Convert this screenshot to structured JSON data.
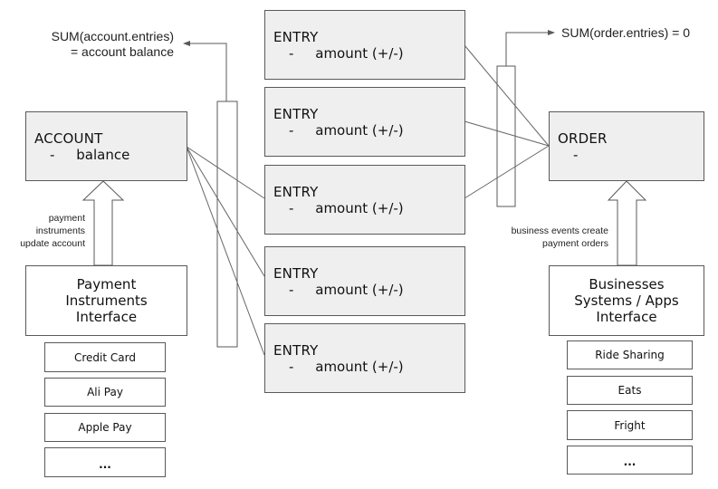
{
  "colors": {
    "box_fill": "#efefef",
    "stroke": "#595959",
    "background": "#ffffff"
  },
  "account": {
    "title": "ACCOUNT",
    "field": "-     balance"
  },
  "order": {
    "title": "ORDER",
    "field": "-"
  },
  "entries": [
    {
      "title": "ENTRY",
      "field": "-     amount (+/-)"
    },
    {
      "title": "ENTRY",
      "field": "-     amount (+/-)"
    },
    {
      "title": "ENTRY",
      "field": "-     amount (+/-)"
    },
    {
      "title": "ENTRY",
      "field": "-     amount (+/-)"
    },
    {
      "title": "ENTRY",
      "field": "-     amount (+/-)"
    }
  ],
  "annotations": {
    "account_sum_line1": "SUM(account.entries)",
    "account_sum_line2": "= account balance",
    "order_sum": "SUM(order.entries) = 0",
    "payment_update": "payment\ninstruments\nupdate account",
    "business_events": "business events create\npayment orders"
  },
  "payment_interface": {
    "label": "Payment\nInstruments\nInterface",
    "items": [
      "Credit Card",
      "Ali Pay",
      "Apple Pay",
      "..."
    ]
  },
  "business_interface": {
    "label": "Businesses\nSystems / Apps\nInterface",
    "items": [
      "Ride Sharing",
      "Eats",
      "Fright",
      "..."
    ]
  }
}
